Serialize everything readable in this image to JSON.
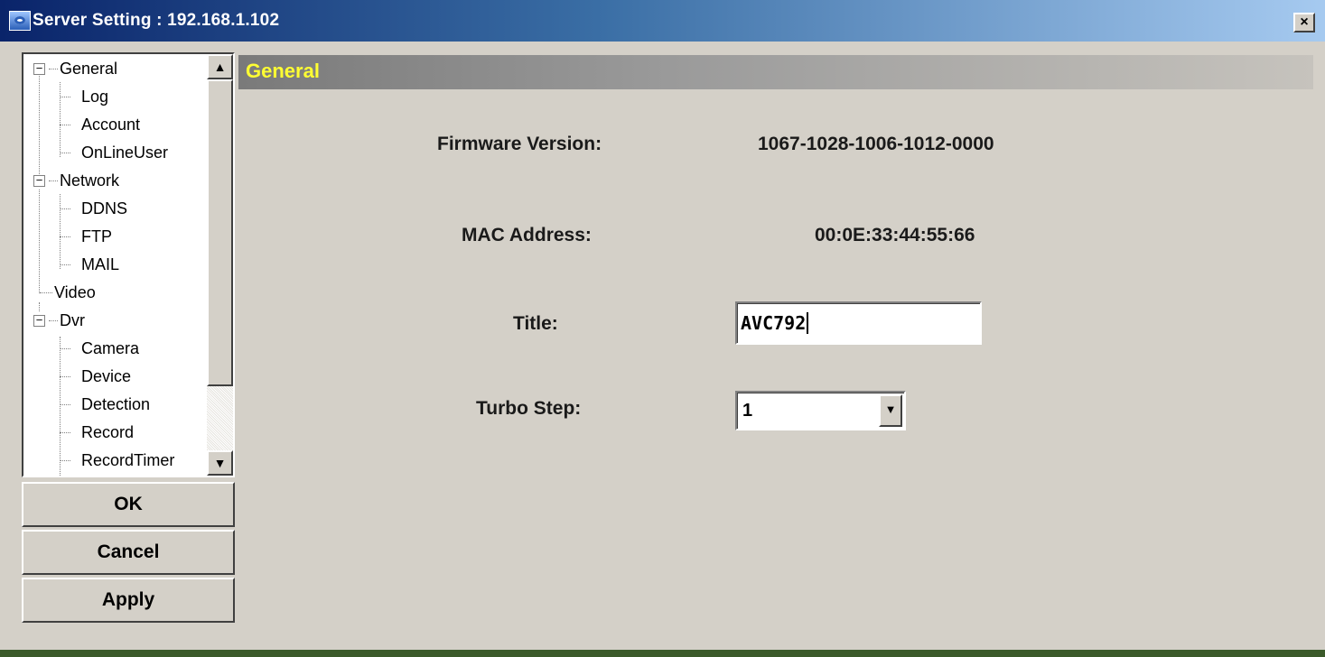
{
  "window": {
    "title": "Server Setting : 192.168.1.102",
    "close_glyph": "×"
  },
  "tree": {
    "items": [
      {
        "label": "General",
        "expander": "−"
      },
      {
        "label": "Log"
      },
      {
        "label": "Account"
      },
      {
        "label": "OnLineUser"
      },
      {
        "label": "Network",
        "expander": "−"
      },
      {
        "label": "DDNS"
      },
      {
        "label": "FTP"
      },
      {
        "label": "MAIL"
      },
      {
        "label": "Video"
      },
      {
        "label": "Dvr",
        "expander": "−"
      },
      {
        "label": "Camera"
      },
      {
        "label": "Device"
      },
      {
        "label": "Detection"
      },
      {
        "label": "Record"
      },
      {
        "label": "RecordTimer"
      }
    ],
    "scroll_up_glyph": "▲",
    "scroll_down_glyph": "▼"
  },
  "buttons": {
    "ok": "OK",
    "cancel": "Cancel",
    "apply": "Apply"
  },
  "section": {
    "title": "General"
  },
  "fields": {
    "firmware_label": "Firmware Version:",
    "firmware_value": "1067-1028-1006-1012-0000",
    "mac_label": "MAC Address:",
    "mac_value": "00:0E:33:44:55:66",
    "title_label": "Title:",
    "title_value": "AVC792",
    "turbo_label": "Turbo Step:",
    "turbo_value": "1",
    "dropdown_glyph": "▼"
  },
  "colors": {
    "titlebar_start": "#0a246a",
    "section_title": "#ffff33",
    "face": "#d4d0c8"
  }
}
